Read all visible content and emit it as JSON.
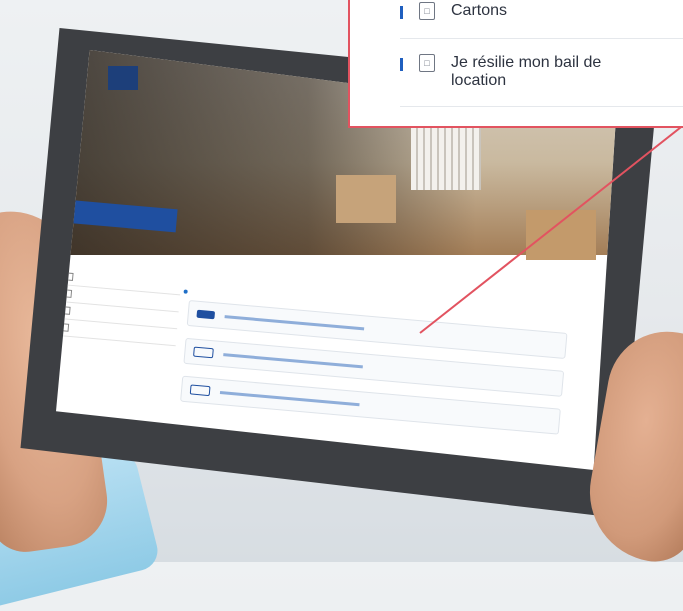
{
  "callout": {
    "items": [
      {
        "icon": "box-icon",
        "label": "Cartons"
      },
      {
        "icon": "document-icon",
        "label": "Je résilie mon bail de location"
      }
    ]
  },
  "colors": {
    "callout_border": "#e25360",
    "accent_blue": "#1f4fa0",
    "tablet_frame": "#3d3f43"
  }
}
